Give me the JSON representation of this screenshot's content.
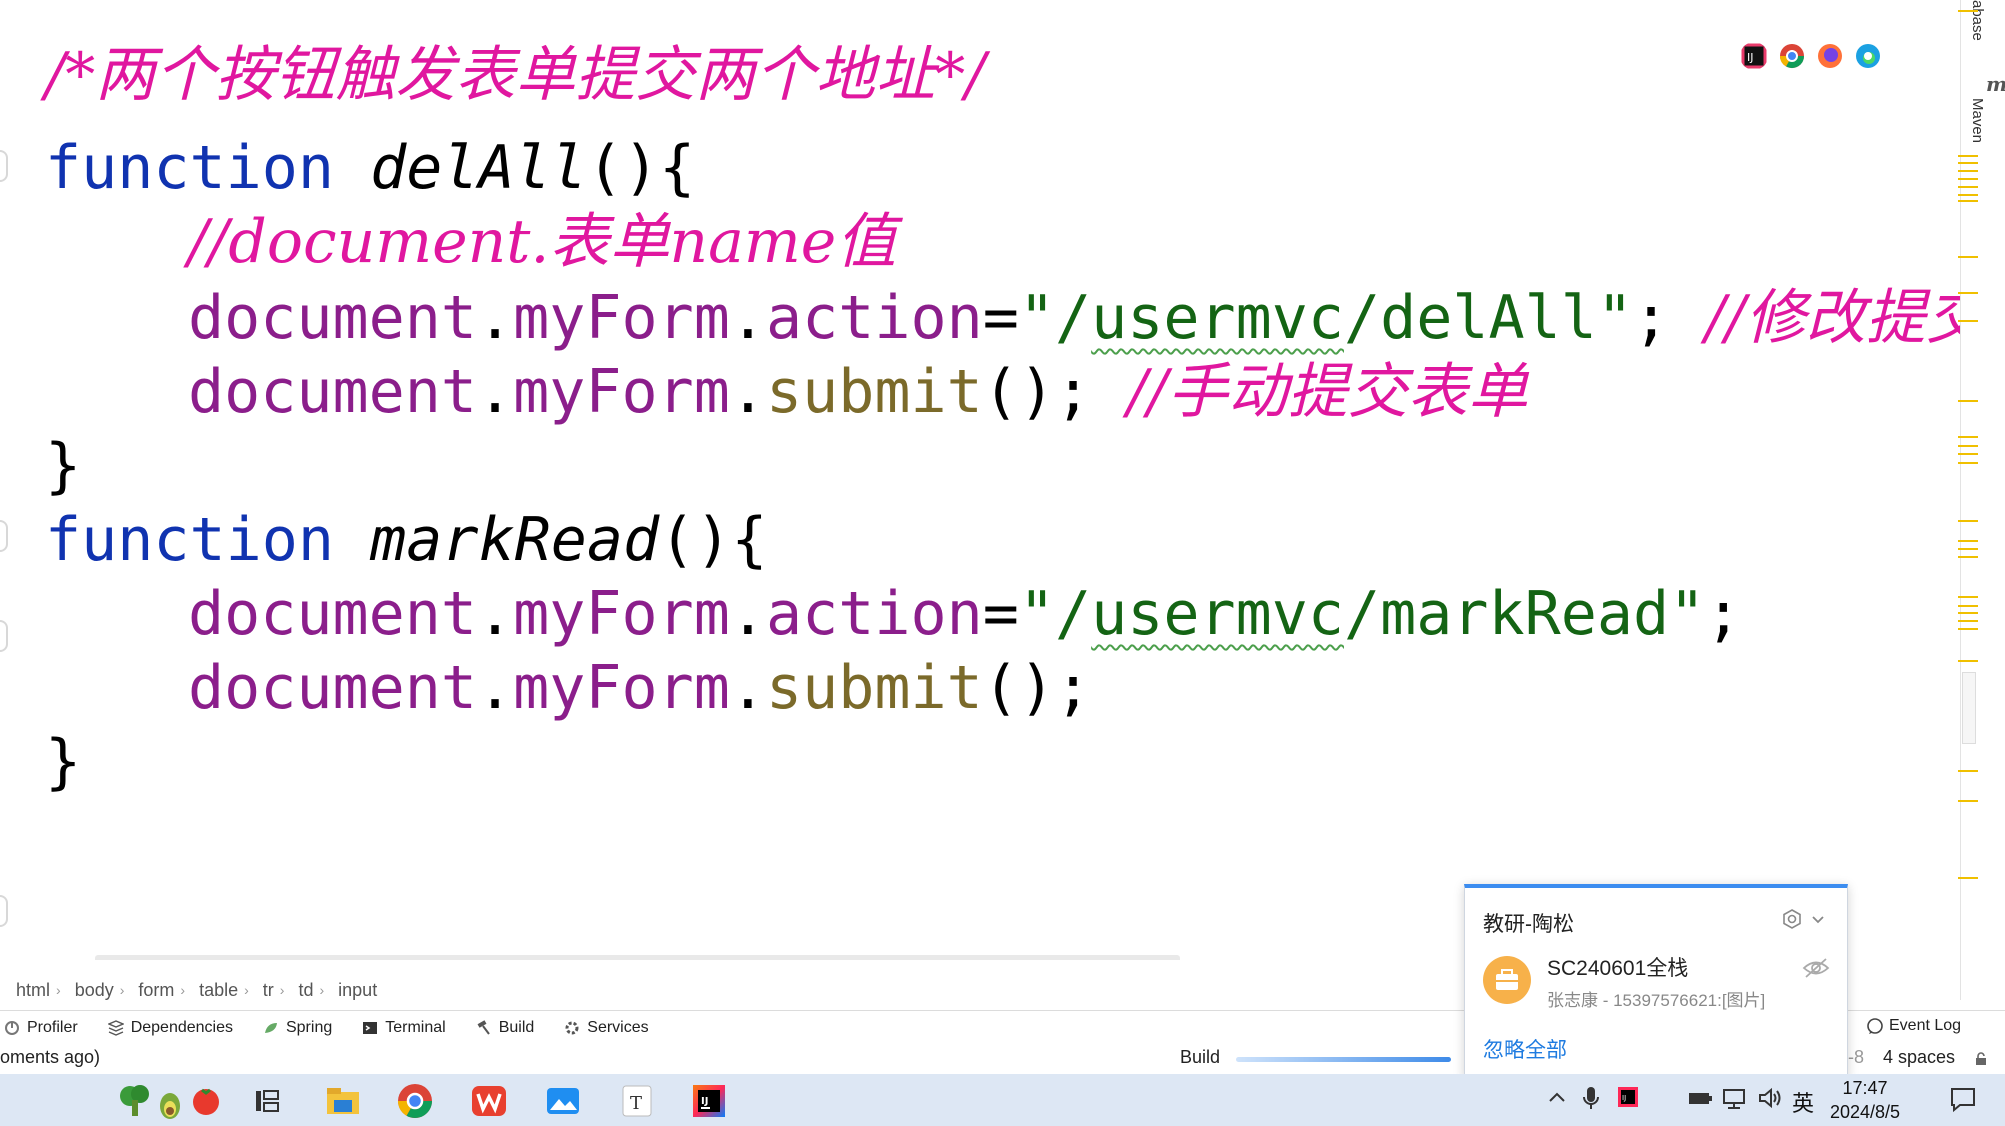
{
  "editor": {
    "lines": [
      {
        "id": "l1",
        "segments": [
          {
            "cls": "c-comment",
            "text": "/*两个按钮触发表单提交两个地址*/"
          }
        ]
      },
      {
        "id": "l2",
        "segments": [
          {
            "cls": "c-kw",
            "text": "function"
          },
          {
            "cls": "c-punc",
            "text": " "
          },
          {
            "cls": "c-fn",
            "text": "delAll"
          },
          {
            "cls": "c-punc",
            "text": "(){"
          }
        ]
      },
      {
        "id": "l3",
        "indent": 2,
        "segments": [
          {
            "cls": "c-comment",
            "text": "//document.表单name值"
          }
        ]
      },
      {
        "id": "l4",
        "indent": 2,
        "segments": [
          {
            "cls": "c-obj",
            "text": "document"
          },
          {
            "cls": "c-punc",
            "text": "."
          },
          {
            "cls": "c-obj",
            "text": "myForm"
          },
          {
            "cls": "c-punc",
            "text": "."
          },
          {
            "cls": "c-obj",
            "text": "action"
          },
          {
            "cls": "c-punc",
            "text": "="
          },
          {
            "cls": "c-str",
            "text": "\"/"
          },
          {
            "cls": "c-str squiggle",
            "text": "usermvc"
          },
          {
            "cls": "c-str",
            "text": "/delAll\""
          },
          {
            "cls": "c-punc",
            "text": "; "
          },
          {
            "cls": "c-comment",
            "text": "//修改提交"
          }
        ]
      },
      {
        "id": "l5",
        "indent": 2,
        "segments": [
          {
            "cls": "c-obj",
            "text": "document"
          },
          {
            "cls": "c-punc",
            "text": "."
          },
          {
            "cls": "c-obj",
            "text": "myForm"
          },
          {
            "cls": "c-punc",
            "text": "."
          },
          {
            "cls": "c-call",
            "text": "submit"
          },
          {
            "cls": "c-punc",
            "text": "(); "
          },
          {
            "cls": "c-comment",
            "text": "//手动提交表单"
          }
        ]
      },
      {
        "id": "l6",
        "segments": [
          {
            "cls": "c-punc",
            "text": "}"
          }
        ]
      },
      {
        "id": "l7",
        "segments": [
          {
            "cls": "c-kw",
            "text": "function"
          },
          {
            "cls": "c-punc",
            "text": " "
          },
          {
            "cls": "c-fn",
            "text": "markRead"
          },
          {
            "cls": "c-punc",
            "text": "(){"
          }
        ]
      },
      {
        "id": "l8",
        "indent": 2,
        "segments": [
          {
            "cls": "c-obj",
            "text": "document"
          },
          {
            "cls": "c-punc",
            "text": "."
          },
          {
            "cls": "c-obj",
            "text": "myForm"
          },
          {
            "cls": "c-punc",
            "text": "."
          },
          {
            "cls": "c-obj",
            "text": "action"
          },
          {
            "cls": "c-punc",
            "text": "="
          },
          {
            "cls": "c-str",
            "text": "\"/"
          },
          {
            "cls": "c-str squiggle",
            "text": "usermvc"
          },
          {
            "cls": "c-str",
            "text": "/markRead\""
          },
          {
            "cls": "c-punc",
            "text": ";"
          }
        ]
      },
      {
        "id": "l9",
        "indent": 2,
        "segments": [
          {
            "cls": "c-obj",
            "text": "document"
          },
          {
            "cls": "c-punc",
            "text": "."
          },
          {
            "cls": "c-obj",
            "text": "myForm"
          },
          {
            "cls": "c-punc",
            "text": "."
          },
          {
            "cls": "c-call",
            "text": "submit"
          },
          {
            "cls": "c-punc",
            "text": "();"
          }
        ]
      },
      {
        "id": "l10",
        "segments": [
          {
            "cls": "c-punc",
            "text": "}"
          }
        ]
      }
    ]
  },
  "side_tools": {
    "database": "abase",
    "maven": "Maven",
    "maven_icon": "m"
  },
  "breadcrumb": [
    "html",
    "body",
    "form",
    "table",
    "tr",
    "td",
    "input"
  ],
  "tool_windows": [
    {
      "label": "Profiler",
      "icon": "profiler-icon"
    },
    {
      "label": "Dependencies",
      "icon": "dependencies-icon"
    },
    {
      "label": "Spring",
      "icon": "spring-icon"
    },
    {
      "label": "Terminal",
      "icon": "terminal-icon"
    },
    {
      "label": "Build",
      "icon": "hammer-icon"
    },
    {
      "label": "Services",
      "icon": "services-icon"
    }
  ],
  "event_log": "Event Log",
  "status": {
    "message": "oments ago)",
    "build_label": "Build",
    "encoding_fragment": "-8",
    "indent": "4 spaces"
  },
  "notification": {
    "title": "教研-陶松",
    "group": "SC240601全栈",
    "message": "张志康 - 15397576621:[图片]",
    "ignore_all": "忽略全部"
  },
  "taskbar": {
    "ime": "英",
    "time": "17:47",
    "date": "2024/8/5"
  },
  "colors": {
    "comment": "#e0179f",
    "keyword": "#1033b0",
    "object": "#8b1e8b",
    "string": "#146414",
    "call": "#7b6a2a",
    "accent": "#3c8df0"
  }
}
